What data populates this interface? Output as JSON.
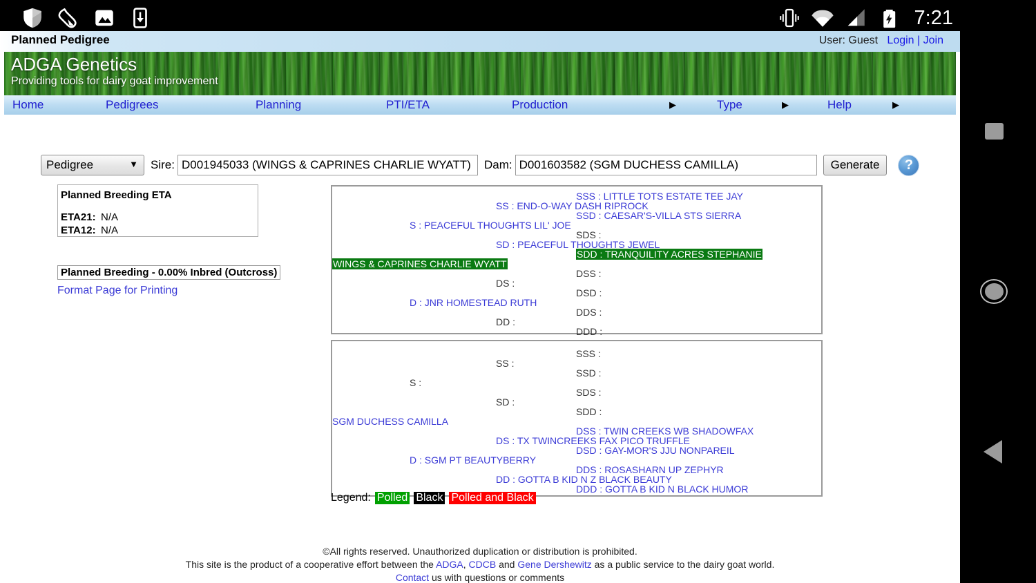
{
  "status_bar": {
    "clock": "7:21",
    "left_icons": [
      "shield-icon",
      "pepper-icon",
      "gallery-icon",
      "download-to-device-icon"
    ],
    "right_icons": [
      "vibrate-icon",
      "wifi-icon",
      "cell-signal-icon",
      "battery-charging-icon"
    ]
  },
  "title_strip": {
    "page_title": "Planned Pedigree",
    "user_label": "User: Guest",
    "login_label": "Login",
    "separator": "|",
    "join_label": "Join"
  },
  "banner": {
    "title": "ADGA Genetics",
    "subtitle": "Providing tools for dairy goat improvement"
  },
  "nav": {
    "items": [
      {
        "label": "Home",
        "has_caret": false
      },
      {
        "label": "Pedigrees",
        "has_caret": false
      },
      {
        "label": "Planning",
        "has_caret": false
      },
      {
        "label": "PTI/ETA",
        "has_caret": false
      },
      {
        "label": "Production",
        "has_caret": true
      },
      {
        "label": "Type",
        "has_caret": true
      },
      {
        "label": "Help",
        "has_caret": true
      }
    ],
    "caret_glyph": "▶"
  },
  "toolbar": {
    "mode_selected": "Pedigree",
    "mode_caret": "▼",
    "sire_label": "Sire:",
    "sire_value": "D001945033 (WINGS & CAPRINES CHARLIE WYATT)",
    "dam_label": "Dam:",
    "dam_value": "D001603582 (SGM DUCHESS CAMILLA)",
    "generate_label": "Generate",
    "help_glyph": "?"
  },
  "eta_panel": {
    "heading": "Planned Breeding ETA",
    "rows": [
      {
        "label": "ETA21:",
        "value": "N/A"
      },
      {
        "label": "ETA12:",
        "value": "N/A"
      }
    ]
  },
  "inbred_box": {
    "text": "Planned Breeding - 0.00% Inbred (Outcross)"
  },
  "print_link": "Format Page for Printing",
  "pedigree_sire": {
    "root": {
      "text": "WINGS & CAPRINES CHARLIE WYATT",
      "style": "green"
    },
    "entries": [
      {
        "text": "SSS : LITTLE TOTS ESTATE TEE JAY",
        "style": "link"
      },
      {
        "text": "SS : END-O-WAY DASH RIPROCK",
        "style": "link"
      },
      {
        "text": "SSD : CAESAR'S-VILLA STS SIERRA",
        "style": "link"
      },
      {
        "text": "S : PEACEFUL THOUGHTS LIL' JOE",
        "style": "link"
      },
      {
        "text": "SDS :",
        "style": "plain"
      },
      {
        "text": "SD : PEACEFUL THOUGHTS JEWEL",
        "style": "link"
      },
      {
        "text": "SDD : TRANQUILITY ACRES STEPHANIE",
        "style": "green"
      },
      {
        "text": "DSS :",
        "style": "plain"
      },
      {
        "text": "DS :",
        "style": "plain"
      },
      {
        "text": "DSD :",
        "style": "plain"
      },
      {
        "text": "D : JNR HOMESTEAD RUTH",
        "style": "link"
      },
      {
        "text": "DDS :",
        "style": "plain"
      },
      {
        "text": "DD :",
        "style": "plain"
      },
      {
        "text": "DDD :",
        "style": "plain"
      }
    ]
  },
  "pedigree_dam": {
    "root": {
      "text": "SGM DUCHESS CAMILLA",
      "style": "link"
    },
    "entries": [
      {
        "text": "SSS :",
        "style": "plain"
      },
      {
        "text": "SS :",
        "style": "plain"
      },
      {
        "text": "SSD :",
        "style": "plain"
      },
      {
        "text": "S :",
        "style": "plain"
      },
      {
        "text": "SDS :",
        "style": "plain"
      },
      {
        "text": "SD :",
        "style": "plain"
      },
      {
        "text": "SDD :",
        "style": "plain"
      },
      {
        "text": "DSS : TWIN CREEKS WB SHADOWFAX",
        "style": "link"
      },
      {
        "text": "DS : TX TWINCREEKS FAX PICO TRUFFLE",
        "style": "link"
      },
      {
        "text": "DSD : GAY-MOR'S JJU NONPAREIL",
        "style": "link"
      },
      {
        "text": "D : SGM PT BEAUTYBERRY",
        "style": "link"
      },
      {
        "text": "DDS : ROSASHARN UP ZEPHYR",
        "style": "link"
      },
      {
        "text": "DD : GOTTA B KID N Z BLACK BEAUTY",
        "style": "link"
      },
      {
        "text": "DDD : GOTTA B KID N BLACK HUMOR",
        "style": "link"
      }
    ]
  },
  "legend": {
    "label": "Legend:",
    "polled": "Polled",
    "black": "Black",
    "polled_and_black": "Polled and Black"
  },
  "footer": {
    "line1": "©All rights reserved. Unauthorized duplication or distribution is prohibited.",
    "line2_a": "This site is the product of a cooperative effort between the ",
    "line2_adga": "ADGA",
    "line2_b": ", ",
    "line2_cdcb": "CDCB",
    "line2_c": " and ",
    "line2_gene": "Gene Dershewitz",
    "line2_d": " as a public service to the dairy goat world.",
    "line3_contact": "Contact",
    "line3_rest": " us with questions or comments"
  },
  "android_nav": {
    "recents": "recents-square-button",
    "home": "home-circle-button",
    "back": "back-triangle-button"
  },
  "colors": {
    "link": "#3b3bd6",
    "green_highlight": "#0a7a12",
    "legend_polled": "#00a000",
    "legend_black": "#000000",
    "legend_both": "#ff0000"
  }
}
